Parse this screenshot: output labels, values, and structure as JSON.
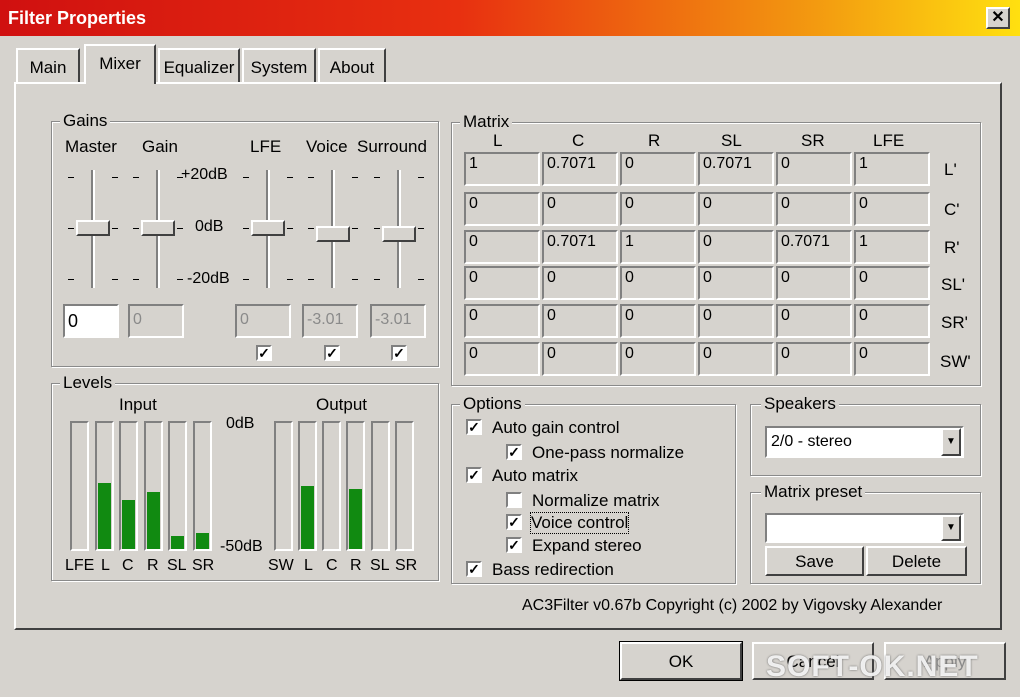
{
  "window": {
    "title": "Filter Properties",
    "close_glyph": "✕"
  },
  "tabs": [
    "Main",
    "Mixer",
    "Equalizer",
    "System",
    "About"
  ],
  "gains": {
    "title": "Gains",
    "labels": {
      "master": "Master",
      "gain": "Gain",
      "lfe": "LFE",
      "voice": "Voice",
      "surround": "Surround"
    },
    "scale": {
      "top": "+20dB",
      "mid": "0dB",
      "bottom": "-20dB"
    },
    "values": {
      "master": "0",
      "gain": "0",
      "lfe": "0",
      "voice": "-3.01",
      "surround": "-3.01"
    },
    "checks": {
      "lfe": "✓",
      "voice": "✓",
      "surround": "✓"
    }
  },
  "levels": {
    "title": "Levels",
    "input_label": "Input",
    "output_label": "Output",
    "scale_top": "0dB",
    "scale_bottom": "-50dB",
    "input_channels": [
      "LFE",
      "L",
      "C",
      "R",
      "SL",
      "SR"
    ],
    "output_channels": [
      "SW",
      "L",
      "C",
      "R",
      "SL",
      "SR"
    ],
    "input_levels": [
      0,
      0.52,
      0.39,
      0.45,
      0.1,
      0.13
    ],
    "output_levels": [
      0,
      0.5,
      0,
      0.48,
      0,
      0
    ],
    "bar_color": "#118a11"
  },
  "matrix": {
    "title": "Matrix",
    "columns": [
      "L",
      "C",
      "R",
      "SL",
      "SR",
      "LFE"
    ],
    "rows": [
      {
        "label": "L'",
        "values": [
          "1",
          "0.7071",
          "0",
          "0.7071",
          "0",
          "1"
        ]
      },
      {
        "label": "C'",
        "values": [
          "0",
          "0",
          "0",
          "0",
          "0",
          "0"
        ]
      },
      {
        "label": "R'",
        "values": [
          "0",
          "0.7071",
          "1",
          "0",
          "0.7071",
          "1"
        ]
      },
      {
        "label": "SL'",
        "values": [
          "0",
          "0",
          "0",
          "0",
          "0",
          "0"
        ]
      },
      {
        "label": "SR'",
        "values": [
          "0",
          "0",
          "0",
          "0",
          "0",
          "0"
        ]
      },
      {
        "label": "SW'",
        "values": [
          "0",
          "0",
          "0",
          "0",
          "0",
          "0"
        ]
      }
    ]
  },
  "options": {
    "title": "Options",
    "auto_gain": {
      "label": "Auto gain control",
      "mark": "✓"
    },
    "one_pass": {
      "label": "One-pass normalize",
      "mark": "✓"
    },
    "auto_matrix": {
      "label": "Auto matrix",
      "mark": "✓"
    },
    "normalize_matrix": {
      "label": "Normalize matrix",
      "mark": ""
    },
    "voice_control": {
      "label": "Voice control",
      "mark": "✓"
    },
    "expand_stereo": {
      "label": "Expand stereo",
      "mark": "✓"
    },
    "bass_redirection": {
      "label": "Bass redirection",
      "mark": "✓"
    }
  },
  "speakers": {
    "title": "Speakers",
    "selected": "2/0 - stereo",
    "arrow": "▼"
  },
  "preset": {
    "title": "Matrix preset",
    "value": "",
    "arrow": "▼",
    "save_label": "Save",
    "delete_label": "Delete"
  },
  "copyright": "AC3Filter v0.67b Copyright (c) 2002 by Vigovsky Alexander",
  "footer": {
    "ok_label": "OK",
    "cancel_label": "Cancel",
    "apply_label": "Apply"
  },
  "watermark": "SOFT-OK.NET"
}
